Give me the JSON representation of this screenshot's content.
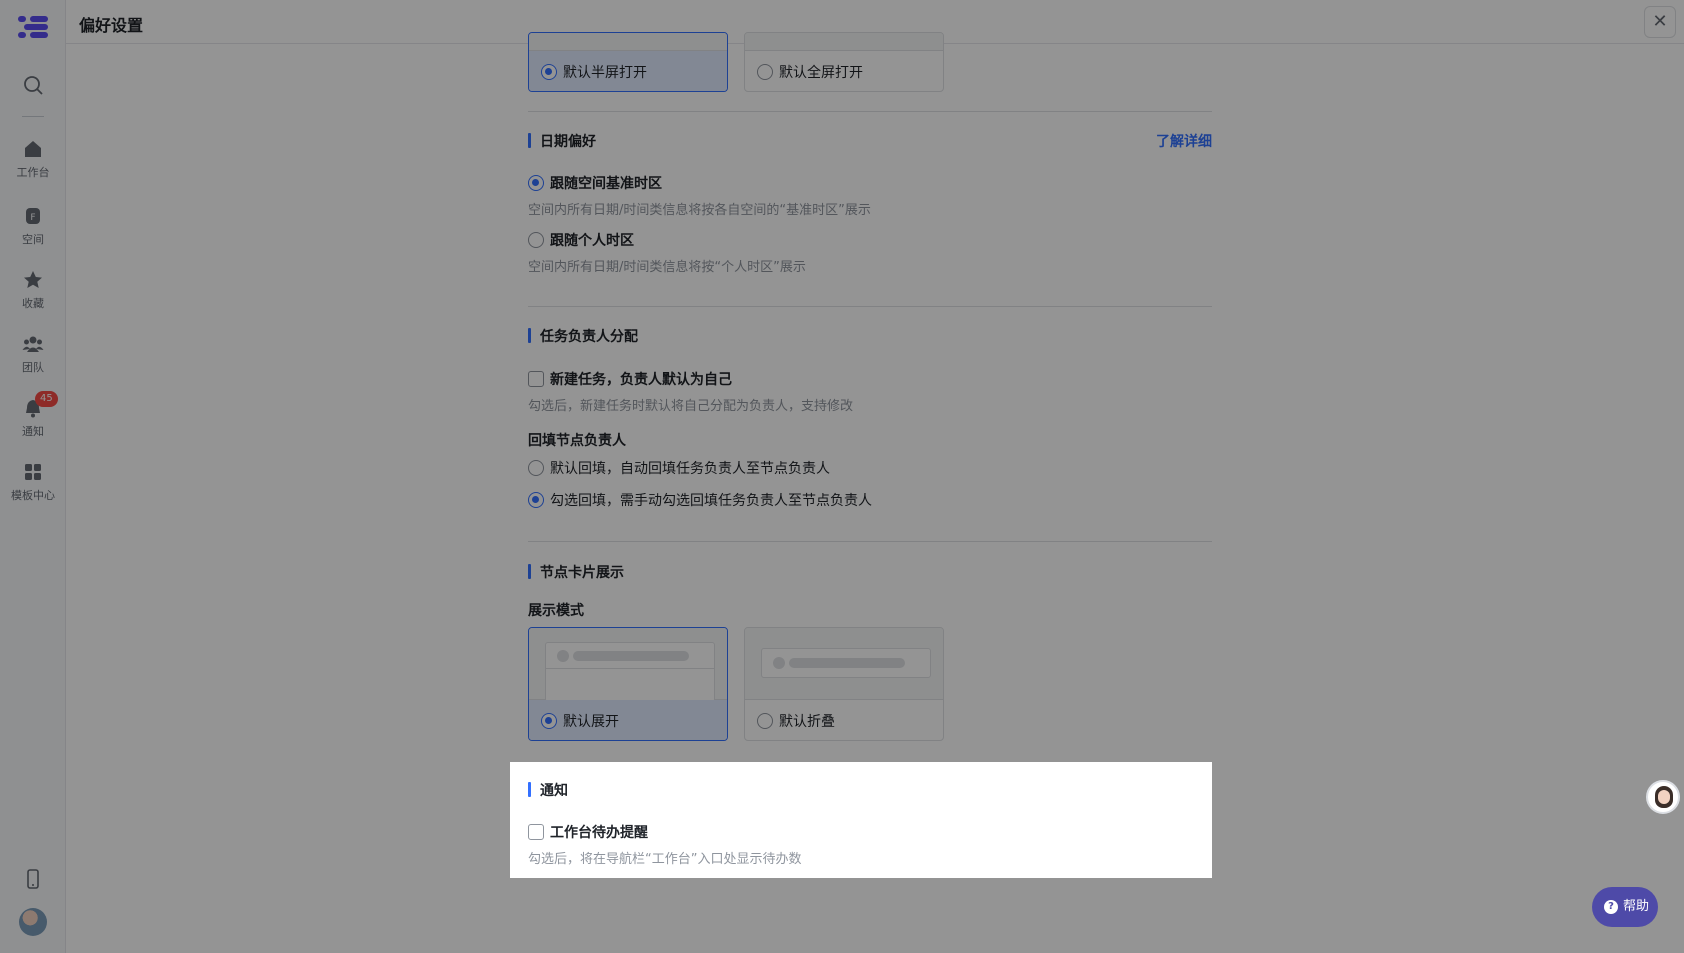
{
  "window": {
    "title": "偏好设置"
  },
  "sidebar": {
    "items": [
      {
        "label": "工作台",
        "icon": "home-icon"
      },
      {
        "label": "空间",
        "icon": "space-icon"
      },
      {
        "label": "收藏",
        "icon": "star-icon"
      },
      {
        "label": "团队",
        "icon": "team-icon"
      },
      {
        "label": "通知",
        "icon": "bell-icon",
        "badge": "45"
      },
      {
        "label": "模板中心",
        "icon": "template-grid-icon"
      }
    ]
  },
  "open_mode": {
    "options": [
      {
        "label": "默认半屏打开",
        "selected": true
      },
      {
        "label": "默认全屏打开",
        "selected": false
      }
    ]
  },
  "date_pref": {
    "title": "日期偏好",
    "link": "了解详细",
    "options": [
      {
        "label": "跟随空间基准时区",
        "desc": "空间内所有日期/时间类信息将按各自空间的“基准时区”展示",
        "selected": true
      },
      {
        "label": "跟随个人时区",
        "desc": "空间内所有日期/时间类信息将按“个人时区”展示",
        "selected": false
      }
    ]
  },
  "task_assign": {
    "title": "任务负责人分配",
    "checkbox_label": "新建任务，负责人默认为自己",
    "checkbox_desc": "勾选后，新建任务时默认将自己分配为负责人，支持修改",
    "checked": false,
    "backfill_label": "回填节点负责人",
    "backfill_options": [
      {
        "label": "默认回填，自动回填任务负责人至节点负责人",
        "selected": false
      },
      {
        "label": "勾选回填，需手动勾选回填任务负责人至节点负责人",
        "selected": true
      }
    ]
  },
  "node_card": {
    "title": "节点卡片展示",
    "mode_label": "展示模式",
    "options": [
      {
        "label": "默认展开",
        "selected": true
      },
      {
        "label": "默认折叠",
        "selected": false
      }
    ]
  },
  "notification": {
    "title": "通知",
    "checkbox_label": "工作台待办提醒",
    "checkbox_desc": "勾选后，将在导航栏“工作台”入口处显示待办数",
    "checked": false
  },
  "help": {
    "label": "帮助"
  },
  "colors": {
    "accent": "#3370ff",
    "brand": "#5b4cf0",
    "badge": "#f54a45",
    "help_bg": "#4e4aa8"
  }
}
